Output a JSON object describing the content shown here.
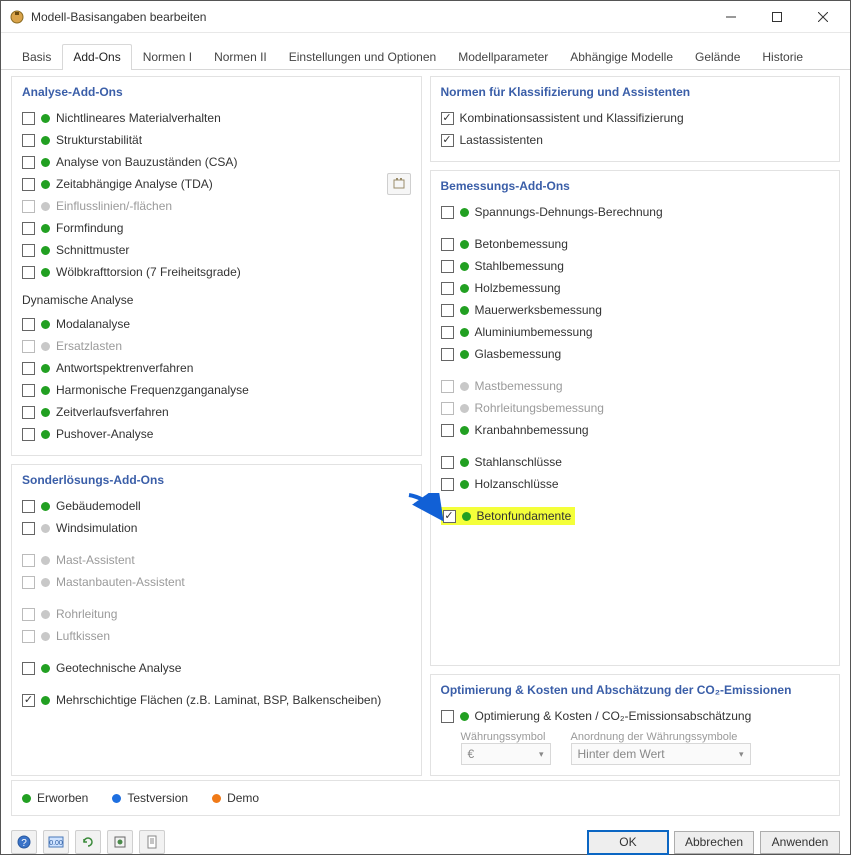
{
  "window": {
    "title": "Modell-Basisangaben bearbeiten"
  },
  "tabs": [
    "Basis",
    "Add-Ons",
    "Normen I",
    "Normen II",
    "Einstellungen und Optionen",
    "Modellparameter",
    "Abhängige Modelle",
    "Gelände",
    "Historie"
  ],
  "active_tab": 1,
  "left": {
    "analysis": {
      "title": "Analyse-Add-Ons",
      "items": [
        {
          "label": "Nichtlineares Materialverhalten",
          "dot": "green",
          "checked": false
        },
        {
          "label": "Strukturstabilität",
          "dot": "green",
          "checked": false
        },
        {
          "label": "Analyse von Bauzuständen (CSA)",
          "dot": "green",
          "checked": false
        },
        {
          "label": "Zeitabhängige Analyse (TDA)",
          "dot": "green",
          "checked": false,
          "ext": true
        },
        {
          "label": "Einflusslinien/-flächen",
          "dot": "grey",
          "checked": false,
          "disabled": true
        },
        {
          "label": "Formfindung",
          "dot": "green",
          "checked": false
        },
        {
          "label": "Schnittmuster",
          "dot": "green",
          "checked": false
        },
        {
          "label": "Wölbkrafttorsion (7 Freiheitsgrade)",
          "dot": "green",
          "checked": false
        }
      ],
      "dyn_title": "Dynamische Analyse",
      "dyn_items": [
        {
          "label": "Modalanalyse",
          "dot": "green",
          "checked": false
        },
        {
          "label": "Ersatzlasten",
          "dot": "grey",
          "checked": false,
          "disabled": true
        },
        {
          "label": "Antwortspektrenverfahren",
          "dot": "green",
          "checked": false
        },
        {
          "label": "Harmonische Frequenzganganalyse",
          "dot": "green",
          "checked": false
        },
        {
          "label": "Zeitverlaufsverfahren",
          "dot": "green",
          "checked": false
        },
        {
          "label": "Pushover-Analyse",
          "dot": "green",
          "checked": false
        }
      ]
    },
    "special": {
      "title": "Sonderlösungs-Add-Ons",
      "items": [
        {
          "label": "Gebäudemodell",
          "dot": "green",
          "checked": false
        },
        {
          "label": "Windsimulation",
          "dot": "grey",
          "checked": false
        },
        {
          "label": "Mast-Assistent",
          "dot": "grey",
          "checked": false,
          "disabled": true,
          "gap": true
        },
        {
          "label": "Mastanbauten-Assistent",
          "dot": "grey",
          "checked": false,
          "disabled": true
        },
        {
          "label": "Rohrleitung",
          "dot": "grey",
          "checked": false,
          "disabled": true,
          "gap": true
        },
        {
          "label": "Luftkissen",
          "dot": "grey",
          "checked": false,
          "disabled": true
        },
        {
          "label": "Geotechnische Analyse",
          "dot": "green",
          "checked": false,
          "gap": true
        },
        {
          "label": "Mehrschichtige Flächen (z.B. Laminat, BSP, Balkenscheiben)",
          "dot": "green",
          "checked": true,
          "gap": true
        }
      ]
    }
  },
  "right": {
    "norms": {
      "title": "Normen für Klassifizierung und Assistenten",
      "items": [
        {
          "label": "Kombinationsassistent und Klassifizierung",
          "checked": true
        },
        {
          "label": "Lastassistenten",
          "checked": true
        }
      ]
    },
    "design": {
      "title": "Bemessungs-Add-Ons",
      "items": [
        {
          "label": "Spannungs-Dehnungs-Berechnung",
          "dot": "green",
          "checked": false
        },
        {
          "label": "Betonbemessung",
          "dot": "green",
          "checked": false,
          "gap": true
        },
        {
          "label": "Stahlbemessung",
          "dot": "green",
          "checked": false
        },
        {
          "label": "Holzbemessung",
          "dot": "green",
          "checked": false
        },
        {
          "label": "Mauerwerksbemessung",
          "dot": "green",
          "checked": false
        },
        {
          "label": "Aluminiumbemessung",
          "dot": "green",
          "checked": false
        },
        {
          "label": "Glasbemessung",
          "dot": "green",
          "checked": false
        },
        {
          "label": "Mastbemessung",
          "dot": "grey",
          "checked": false,
          "disabled": true,
          "gap": true
        },
        {
          "label": "Rohrleitungsbemessung",
          "dot": "grey",
          "checked": false,
          "disabled": true
        },
        {
          "label": "Kranbahnbemessung",
          "dot": "green",
          "checked": false
        },
        {
          "label": "Stahlanschlüsse",
          "dot": "green",
          "checked": false,
          "gap": true
        },
        {
          "label": "Holzanschlüsse",
          "dot": "green",
          "checked": false
        },
        {
          "label": "Betonfundamente",
          "dot": "green",
          "checked": true,
          "gap": true,
          "highlight": true
        }
      ]
    },
    "opt": {
      "title": "Optimierung & Kosten und Abschätzung der CO₂-Emissionen",
      "item": {
        "label": "Optimierung & Kosten / CO₂-Emissionsabschätzung",
        "dot": "green",
        "checked": false
      },
      "currency_lbl": "Währungssymbol",
      "order_lbl": "Anordnung der Währungssymbole",
      "currency_val": "€",
      "order_val": "Hinter dem Wert"
    }
  },
  "legend": {
    "acquired": "Erworben",
    "trial": "Testversion",
    "demo": "Demo"
  },
  "footer": {
    "ok": "OK",
    "cancel": "Abbrechen",
    "apply": "Anwenden"
  }
}
